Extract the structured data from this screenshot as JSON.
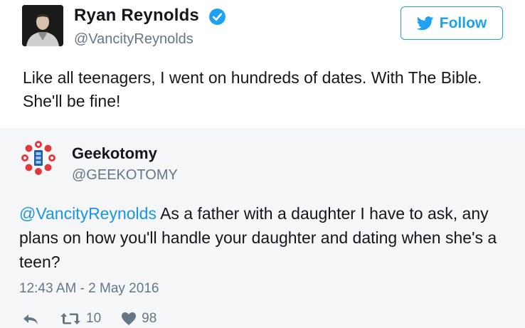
{
  "tweet": {
    "author_name": "Ryan Reynolds",
    "author_handle": "@VancityReynolds",
    "follow_label": "Follow",
    "text": "Like all teenagers, I went on hundreds of dates. With The Bible. She'll be fine!",
    "icons": [
      "avatar-photo",
      "verified-icon",
      "twitter-bird-icon"
    ]
  },
  "quoted": {
    "author_name": "Geekotomy",
    "author_handle": "@GEEKOTOMY",
    "mention": "@VancityReynolds",
    "text": " As a father with a daughter I have to ask, any plans on how you'll handle your daughter and dating when she's a teen?",
    "timestamp": "12:43 AM - 2 May 2016",
    "retweet_count": "10",
    "like_count": "98",
    "icons": [
      "reply-icon",
      "retweet-icon",
      "heart-icon"
    ]
  },
  "colors": {
    "accent": "#1da1f2",
    "mention": "#1b95e0",
    "secondary_text": "#657786",
    "quote_background": "#f4f6f8",
    "logo_red": "#e03a3e",
    "logo_blue": "#1b5fa8"
  }
}
